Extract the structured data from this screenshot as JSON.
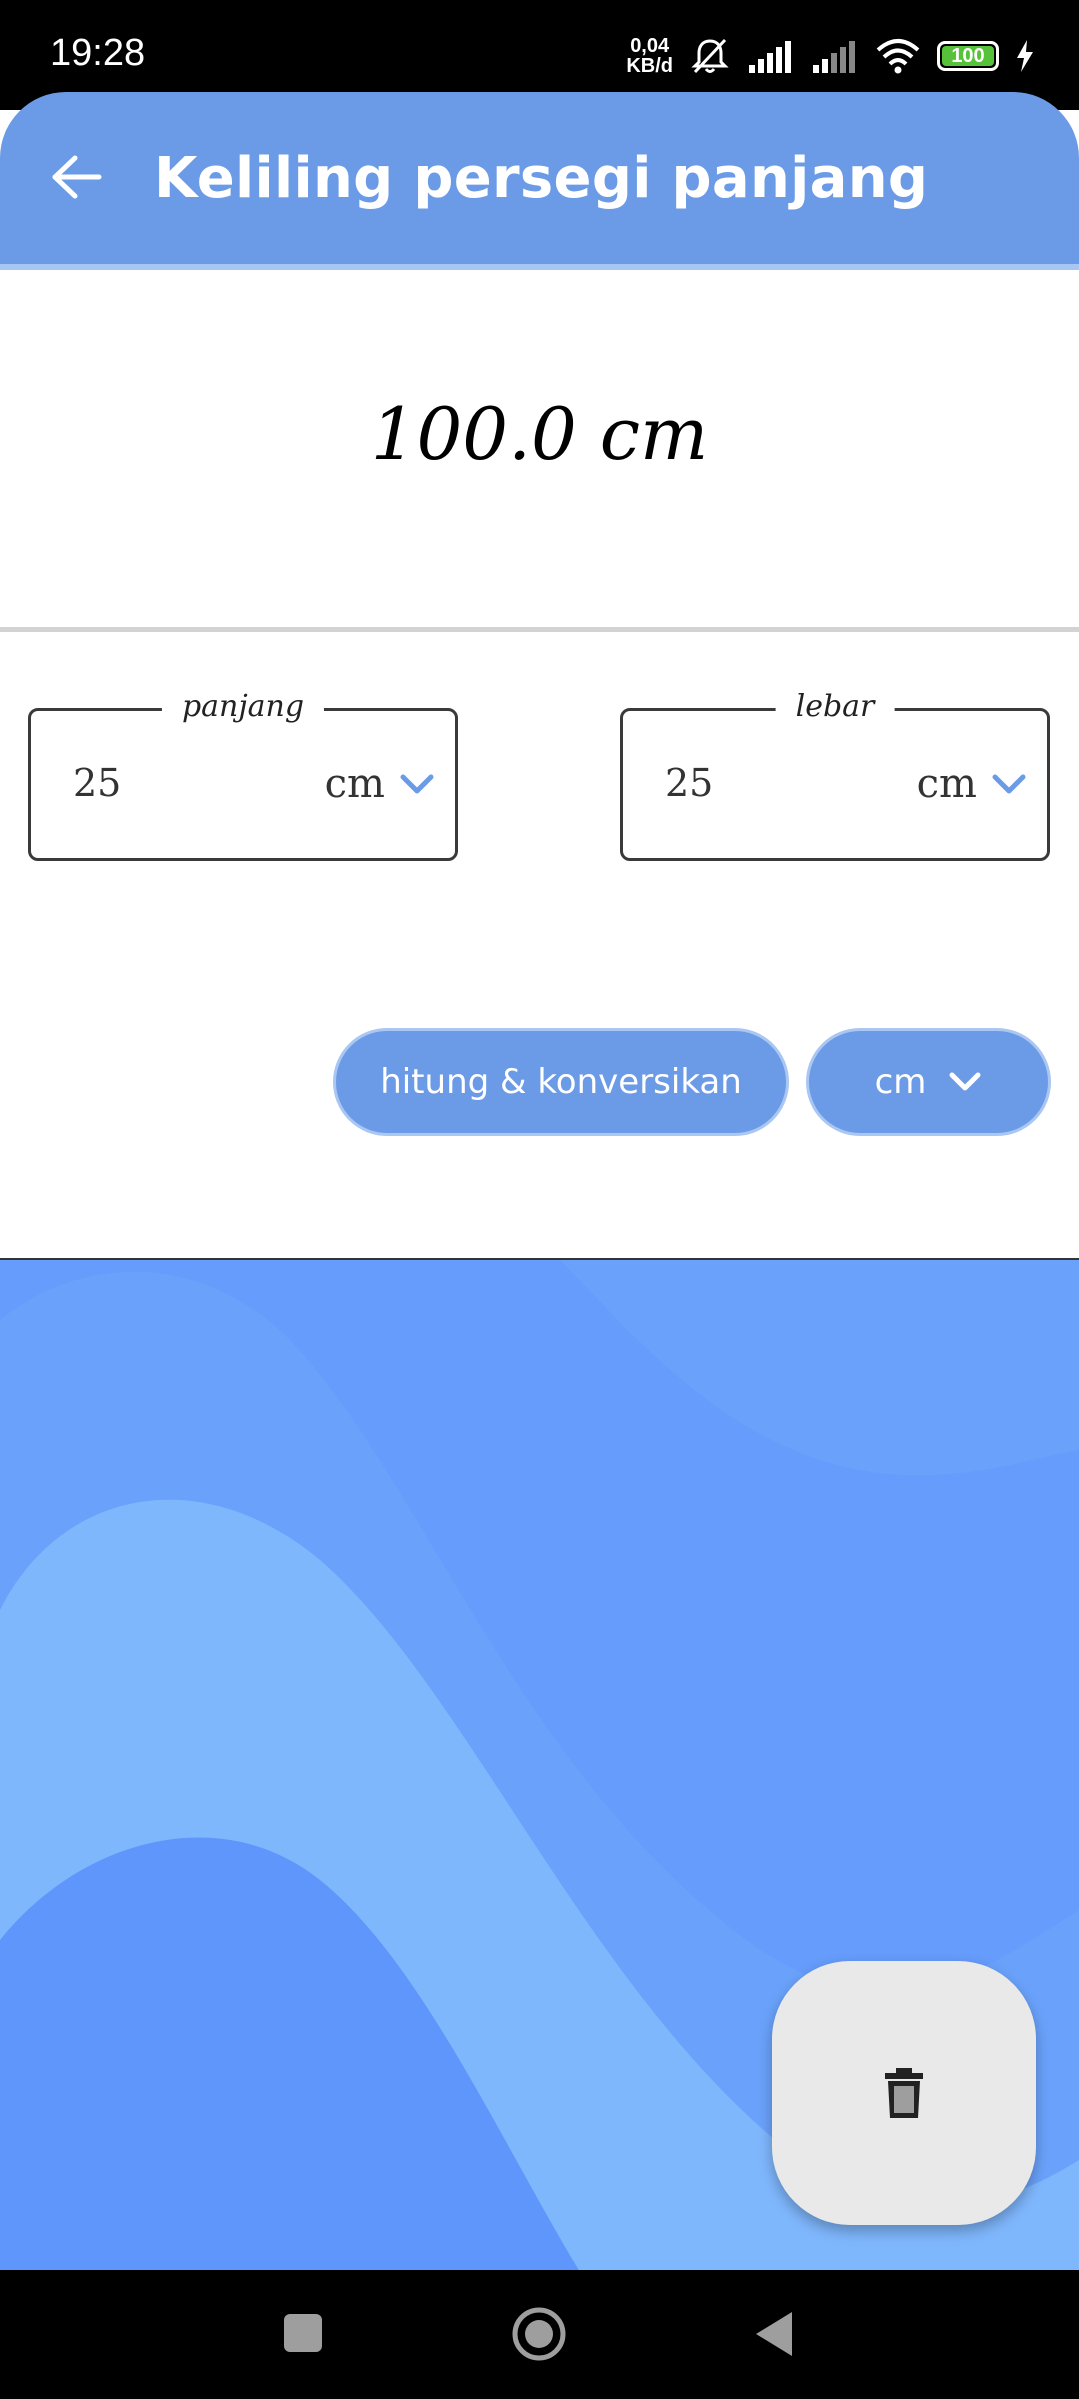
{
  "status_bar": {
    "time": "19:28",
    "netspeed_value": "0,04",
    "netspeed_unit": "KB/d",
    "battery": "100"
  },
  "app_bar": {
    "title": "Keliling persegi panjang",
    "back_icon": "arrow-left-icon"
  },
  "result": {
    "text": "100.0 cm"
  },
  "inputs": [
    {
      "label": "panjang",
      "value": "25",
      "unit": "cm"
    },
    {
      "label": "lebar",
      "value": "25",
      "unit": "cm"
    }
  ],
  "actions": {
    "calculate_label": "hitung & konversikan",
    "unit_select_label": "cm"
  },
  "fab": {
    "icon": "trash-icon"
  },
  "colors": {
    "primary": "#6b9be6",
    "wave_light": "#7fb7fd",
    "wave_mid": "#6aa2fb",
    "wave_dark": "#5f96fc"
  }
}
